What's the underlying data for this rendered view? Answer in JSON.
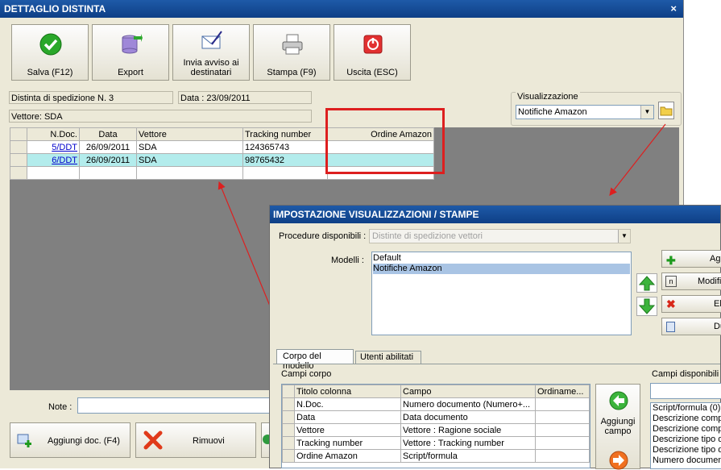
{
  "main": {
    "title": "DETTAGLIO DISTINTA",
    "close": "×",
    "toolbar": [
      {
        "label": "Salva (F12)",
        "icon": "check-icon"
      },
      {
        "label": "Export",
        "icon": "database-export-icon"
      },
      {
        "label": "Invia avviso ai destinatari",
        "icon": "email-icon"
      },
      {
        "label": "Stampa (F9)",
        "icon": "printer-icon"
      },
      {
        "label": "Uscita (ESC)",
        "icon": "exit-icon"
      }
    ],
    "info": {
      "distinta": "Distinta di spedizione N. 3",
      "data": "Data : 23/09/2011",
      "vettore": "Vettore: SDA"
    },
    "visualizzazione": {
      "label": "Visualizzazione",
      "value": "Notifiche Amazon"
    },
    "grid": {
      "columns": [
        "N.Doc.",
        "Data",
        "Vettore",
        "Tracking number",
        "Ordine Amazon"
      ],
      "rows": [
        {
          "ndoc": "5/DDT",
          "data": "26/09/2011",
          "vettore": "SDA",
          "tracking": "124365743",
          "ordine": ""
        },
        {
          "ndoc": "6/DDT",
          "data": "26/09/2011",
          "vettore": "SDA",
          "tracking": "98765432",
          "ordine": ""
        }
      ]
    },
    "note_label": "Note :",
    "note_value": "",
    "bottom": {
      "aggiungi": "Aggiungi doc. (F4)",
      "rimuovi": "Rimuovi"
    }
  },
  "dialog": {
    "title": "IMPOSTAZIONE VISUALIZZAZIONI / STAMPE",
    "procedure_label": "Procedure disponibili :",
    "procedure_value": "Distinte di spedizione vettori",
    "modelli_label": "Modelli :",
    "modelli": [
      "Default",
      "Notifiche Amazon"
    ],
    "side_buttons": [
      "Ag",
      "Modifi",
      "Eli",
      "Du"
    ],
    "tabs": [
      "Corpo del modello",
      "Utenti abilitati"
    ],
    "campi_corpo_label": "Campi corpo",
    "campi_disponibili_label": "Campi disponibili",
    "corpo_columns": [
      "Titolo colonna",
      "Campo",
      "Ordiname..."
    ],
    "corpo_rows": [
      {
        "titolo": "N.Doc.",
        "campo": "Numero documento (Numero+..."
      },
      {
        "titolo": "Data",
        "campo": "Data documento"
      },
      {
        "titolo": "Vettore",
        "campo": "Vettore : Ragione sociale"
      },
      {
        "titolo": "Tracking number",
        "campo": "Vettore : Tracking number"
      },
      {
        "titolo": "Ordine Amazon",
        "campo": "Script/formula"
      }
    ],
    "aggiungi_campo": "Aggiungi campo",
    "disponibili": [
      "Script/formula (0)",
      "Descrizione compl",
      "Descrizione compl",
      "Descrizione tipo d",
      "Descrizione tipo d",
      "Numero documen"
    ]
  },
  "colors": {
    "titlebar": "#1e5aa8",
    "selected_row": "#b3ecec",
    "highlight": "#dd1f1f",
    "grid_bg": "#808080"
  }
}
